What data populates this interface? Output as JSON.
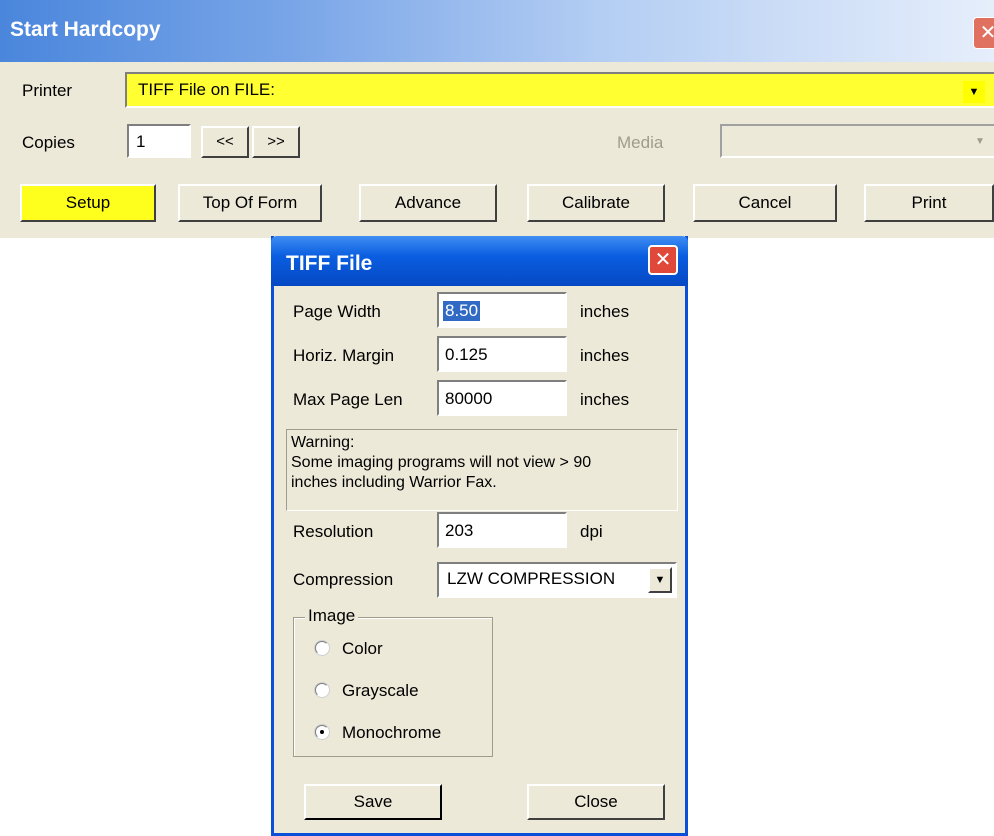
{
  "main_window": {
    "title": "Start Hardcopy",
    "close_glyph": "✕",
    "printer_label": "Printer",
    "printer_value": "TIFF File on FILE:",
    "copies_label": "Copies",
    "copies_value": "1",
    "prev_label": "<<",
    "next_label": ">>",
    "media_label": "Media",
    "media_value": "",
    "buttons": {
      "setup": "Setup",
      "top_of_form": "Top Of Form",
      "advance": "Advance",
      "calibrate": "Calibrate",
      "cancel": "Cancel",
      "print": "Print"
    }
  },
  "dialog": {
    "title": "TIFF File",
    "close_glyph": "✕",
    "page_width_label": "Page Width",
    "page_width_value": "8.50",
    "page_width_unit": "inches",
    "horiz_margin_label": "Horiz. Margin",
    "horiz_margin_value": "0.125",
    "horiz_margin_unit": "inches",
    "max_page_len_label": "Max Page Len",
    "max_page_len_value": "80000",
    "max_page_len_unit": "inches",
    "warning_line1": "Warning:",
    "warning_line2": "Some imaging programs will not view > 90",
    "warning_line3": "inches including Warrior Fax.",
    "resolution_label": "Resolution",
    "resolution_value": "203",
    "resolution_unit": "dpi",
    "compression_label": "Compression",
    "compression_value": "LZW COMPRESSION",
    "image_group_label": "Image",
    "image_options": [
      "Color",
      "Grayscale",
      "Monochrome"
    ],
    "image_selected": "Monochrome",
    "save_label": "Save",
    "close_label": "Close"
  },
  "colors": {
    "highlight": "#ffff1e",
    "dialog_title": "#0a5ee0",
    "face": "#ece9d8"
  }
}
